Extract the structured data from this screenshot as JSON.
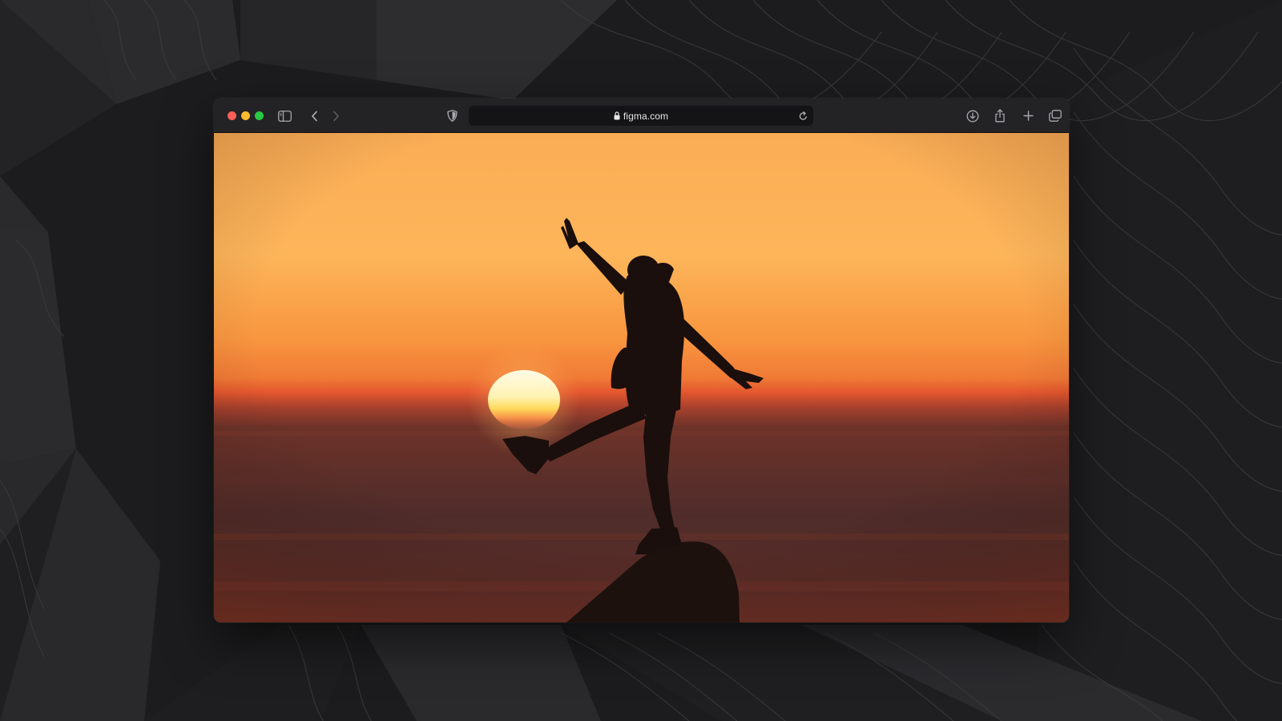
{
  "browser": {
    "address": "figma.com",
    "traffic_lights": {
      "close_color": "#ff5f57",
      "minimize_color": "#febc2e",
      "zoom_color": "#28c840"
    },
    "toolbar_icons": [
      "sidebar-icon",
      "back-icon",
      "forward-icon",
      "shield-icon",
      "lock-icon",
      "reload-icon",
      "download-icon",
      "share-icon",
      "new-tab-icon",
      "tab-overview-icon"
    ]
  },
  "photo": {
    "subject": "silhouette-at-sunset",
    "colors": {
      "sky_top": "#fdb55a",
      "horizon": "#e4572e",
      "sea": "#4a2b2a",
      "sun": "#fff6c8",
      "silhouette": "#1a0f0c"
    }
  },
  "backdrop": {
    "color": "#1c1c1e"
  }
}
